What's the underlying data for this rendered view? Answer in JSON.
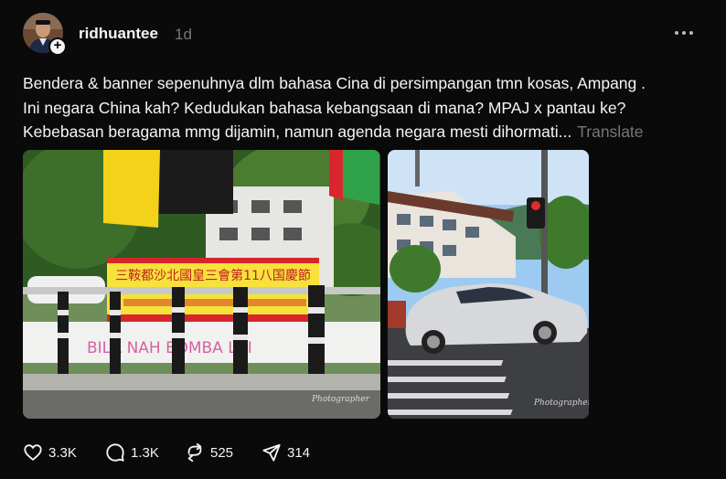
{
  "post": {
    "username": "ridhuantee",
    "time_ago": "1d",
    "caption_lines": [
      "Bendera & banner sepenuhnya dlm bahasa Cina di persimpangan tmn kosas, Ampang .",
      "Ini negara China kah? Kedudukan bahasa kebangsaan di mana? MPAJ x pantau ke?",
      "Kebebasan beragama mmg dijamin, namun agenda negara mesti dihormati..."
    ],
    "translate_label": "Translate",
    "photos": [
      {
        "banner_text": "三鞍都沙北國皇三會第11八国慶節",
        "graffiti": "BILA NAH BOMBA LAI",
        "watermark": "Photographer"
      },
      {
        "watermark": "Photographer"
      }
    ],
    "actions": {
      "likes": "3.3K",
      "comments": "1.3K",
      "reposts": "525",
      "shares": "314"
    }
  },
  "icons": [
    "avatar",
    "plus-icon",
    "more-icon",
    "heart-icon",
    "comment-icon",
    "repost-icon",
    "share-icon"
  ]
}
